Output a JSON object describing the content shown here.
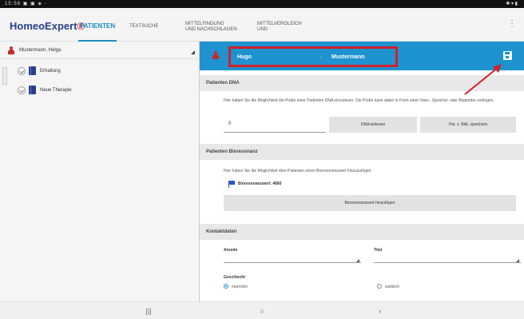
{
  "status_bar": {
    "left": "15:58 ▣ ▣ ◈ ·",
    "right": "✱ ▾ ▮"
  },
  "app": {
    "logo_main": "HomeoExpert",
    "logo_reg": "®",
    "tabs": {
      "patienten": "Patienten",
      "textsuche": "Textsuche",
      "mittelfindung_line1": "Mittelfindung",
      "mittelfindung_line2": "und Nachschlagen",
      "mittelvergleich_line1": "Mittelvergleich",
      "mittelvergleich_line2": "und"
    },
    "menu_icon": "more-vert-icon"
  },
  "sidebar": {
    "patient_name": "Mustermann, Helga",
    "items": [
      {
        "label": "Erhaltung"
      },
      {
        "label": "Neue Therapie"
      }
    ]
  },
  "patient_header": {
    "first_name": "Hugo",
    "separator": ",",
    "last_name": "Mustermann",
    "accent": "#1e93cf",
    "highlight": "#d0202a"
  },
  "dna_section": {
    "title": "Patienten DNA",
    "description": "Hier haben Sie die Möglichkeit die Probe einer Patienten DNA einzulesen. Die Probe kann dabei in Form einer Haar-, Speichel- oder Blutprobe vorliegen.",
    "input_value": "0",
    "read_button": "DNA einlesen",
    "save_button": "Pat. z. Bild. speichern"
  },
  "bio_section": {
    "title": "Patienten Bioresonanz",
    "description": "Hier haben Sie die Möglichkeit dem Patienten einen Bioresonanzwert hinzuzufügen.",
    "result": "Bioresonanzwert: 4660",
    "add_button": "Bioresonanzwert hinzufügen"
  },
  "contact_section": {
    "title": "Kontaktdaten",
    "anrede_label": "Anrede",
    "titel_label": "Titel",
    "gender_label": "Geschlecht",
    "gender_options": [
      "männlich",
      "weiblich"
    ],
    "gender_selected": "männlich"
  },
  "nav": {
    "recents": "|||",
    "home": "○",
    "back": "‹"
  }
}
